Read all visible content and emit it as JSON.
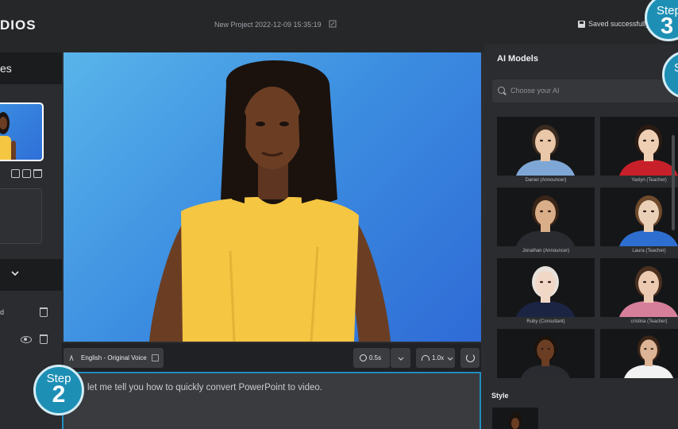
{
  "app": {
    "brand_partial": "DIOS"
  },
  "header": {
    "project_title": "New Project 2022-12-09 15:35:19",
    "save_status": "Saved successfully"
  },
  "steps": {
    "step3": {
      "word": "Step",
      "number": "3"
    },
    "step_partial": {
      "word": "S"
    },
    "step2": {
      "word": "Step",
      "number": "2"
    }
  },
  "left_panel": {
    "scenes_label_partial": "es",
    "layers": [
      {
        "label_partial": "d"
      }
    ]
  },
  "controls": {
    "voice": "English - Original Voice",
    "pause": "0.5s",
    "speed": "1.0x"
  },
  "script": {
    "text": "let me tell you how to quickly convert PowerPoint to video."
  },
  "right_panel": {
    "title": "AI Models",
    "search_placeholder": "Choose your AI",
    "models": [
      {
        "name": "Daniel (Announcer)",
        "skin": "#e9c7a8",
        "hair": "#3b2b1f",
        "top": "#7fa7d6"
      },
      {
        "name": "Yaslyn (Teacher)",
        "skin": "#efcfb4",
        "hair": "#2b1b12",
        "top": "#c8202a"
      },
      {
        "name": "Jonathan (Announcer)",
        "skin": "#d9ae88",
        "hair": "#3a2518",
        "top": "#2a2b30"
      },
      {
        "name": "Laura (Teacher)",
        "skin": "#ead0b6",
        "hair": "#6f4a2c",
        "top": "#2e6ed0"
      },
      {
        "name": "Ruby (Consultant)",
        "skin": "#f1d7c6",
        "hair": "#e8e2dc",
        "top": "#1c2444"
      },
      {
        "name": "cristina (Teacher)",
        "skin": "#eccab2",
        "hair": "#4b3020",
        "top": "#d67f9a"
      },
      {
        "name": "",
        "skin": "#6b3e24",
        "hair": "#1b120c",
        "top": "#2a2b30"
      },
      {
        "name": "",
        "skin": "#ddb495",
        "hair": "#3a2518",
        "top": "#f2f2f2"
      }
    ],
    "style_title": "Style"
  },
  "colors": {
    "accent": "#1f8ec0",
    "stage_top": "#59b4ea",
    "stage_bottom": "#2f6bd6",
    "presenter_top": "#f5c642"
  }
}
